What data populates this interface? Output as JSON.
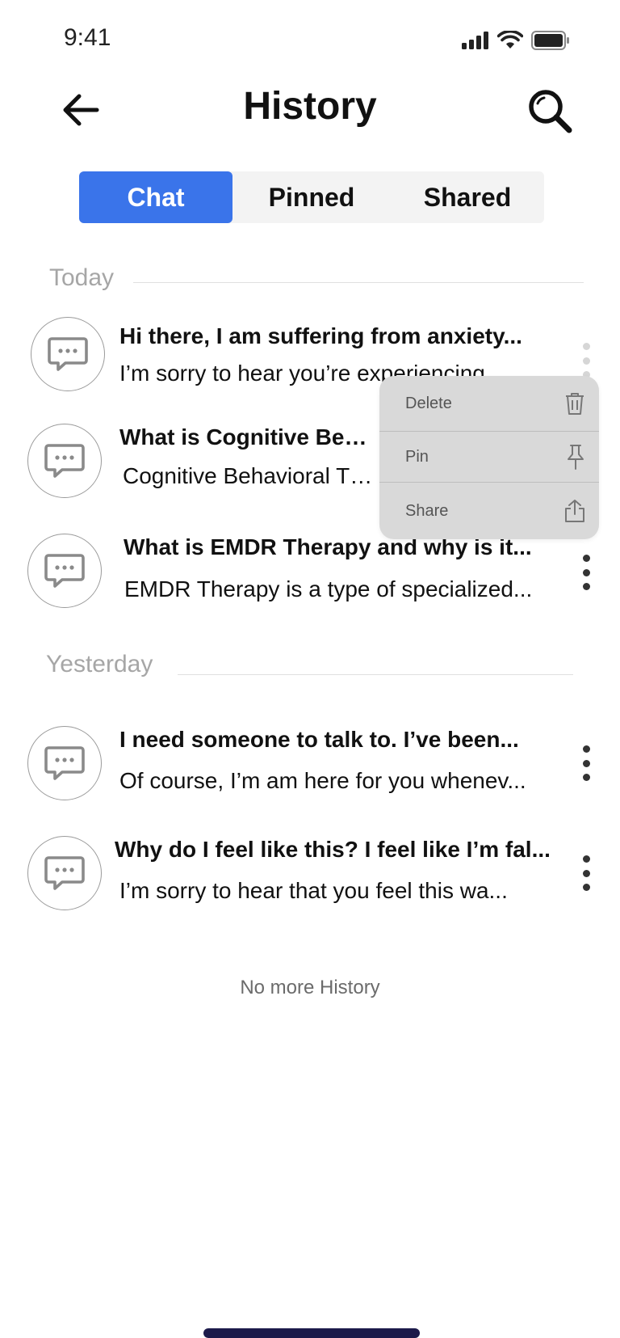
{
  "status_bar": {
    "time": "9:41"
  },
  "header": {
    "title": "History"
  },
  "tabs": [
    {
      "label": "Chat",
      "active": true
    },
    {
      "label": "Pinned",
      "active": false
    },
    {
      "label": "Shared",
      "active": false
    }
  ],
  "sections": {
    "today": "Today",
    "yesterday": "Yesterday"
  },
  "chats": [
    {
      "title": "Hi there, I am suffering from anxiety...",
      "preview": "I’m sorry to hear you’re experiencing"
    },
    {
      "title": "What is Cognitive Behavioral Therapy?",
      "preview": "Cognitive Behavioral Therapy (CBT) is a"
    },
    {
      "title": "What is EMDR Therapy and why is it...",
      "preview": "EMDR Therapy is a type of specialized..."
    },
    {
      "title": "I need someone to talk to. I’ve been...",
      "preview": "Of course, I’m am here for you whenev..."
    },
    {
      "title": "Why do I feel like this? I feel like I’m fal...",
      "preview": "I’m sorry to hear that you feel this wa..."
    }
  ],
  "context_menu": {
    "delete_label": "Delete",
    "pin_label": "Pin",
    "share_label": "Share"
  },
  "footer": {
    "no_more": "No more History"
  },
  "colors": {
    "accent": "#3a74ea",
    "menu_bg": "#d9d9d9",
    "home_indicator": "#1c1a4a"
  }
}
